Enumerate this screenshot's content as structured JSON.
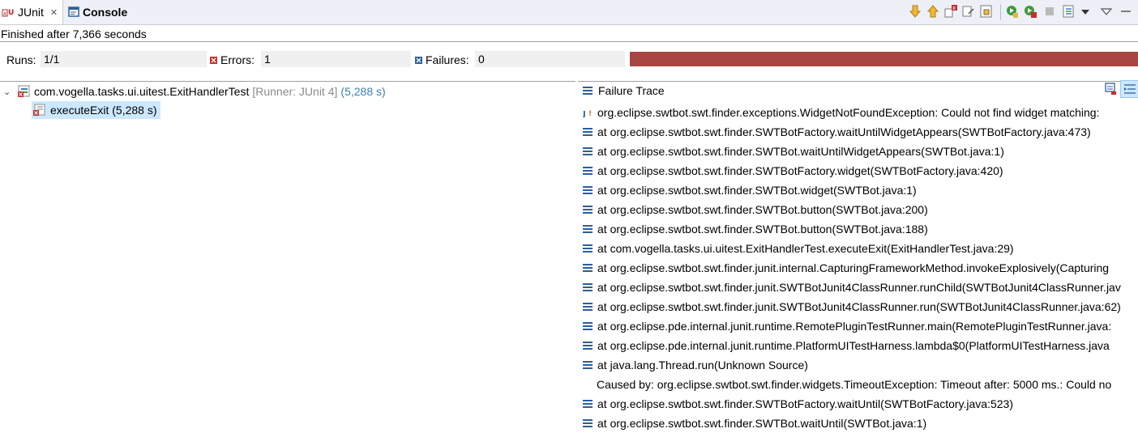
{
  "tabs": [
    {
      "label": "JUnit",
      "active": true
    },
    {
      "label": "Console",
      "active": false
    }
  ],
  "status_text": "Finished after 7,366 seconds",
  "counters": {
    "runs_label": "Runs:",
    "runs_value": "1/1",
    "errors_label": "Errors:",
    "errors_value": "1",
    "failures_label": "Failures:",
    "failures_value": "0"
  },
  "colors": {
    "progress_fail": "#a94543",
    "link_time": "#3a7fb5",
    "selection": "#cce8ff"
  },
  "tree": {
    "suite_label": "com.vogella.tasks.ui.uitest.ExitHandlerTest",
    "suite_runner": "[Runner: JUnit 4]",
    "suite_time": "(5,288 s)",
    "test_label": "executeExit (5,288 s)"
  },
  "failure_trace": {
    "title": "Failure Trace",
    "lines": [
      {
        "icon": "exception-icon",
        "text": "org.eclipse.swtbot.swt.finder.exceptions.WidgetNotFoundException: Could not find widget matching:"
      },
      {
        "icon": "stack-frame-icon",
        "text": "at org.eclipse.swtbot.swt.finder.SWTBotFactory.waitUntilWidgetAppears(SWTBotFactory.java:473)"
      },
      {
        "icon": "stack-frame-icon",
        "text": "at org.eclipse.swtbot.swt.finder.SWTBot.waitUntilWidgetAppears(SWTBot.java:1)"
      },
      {
        "icon": "stack-frame-icon",
        "text": "at org.eclipse.swtbot.swt.finder.SWTBotFactory.widget(SWTBotFactory.java:420)"
      },
      {
        "icon": "stack-frame-icon",
        "text": "at org.eclipse.swtbot.swt.finder.SWTBot.widget(SWTBot.java:1)"
      },
      {
        "icon": "stack-frame-icon",
        "text": "at org.eclipse.swtbot.swt.finder.SWTBot.button(SWTBot.java:200)"
      },
      {
        "icon": "stack-frame-icon",
        "text": "at org.eclipse.swtbot.swt.finder.SWTBot.button(SWTBot.java:188)"
      },
      {
        "icon": "stack-frame-icon",
        "text": "at com.vogella.tasks.ui.uitest.ExitHandlerTest.executeExit(ExitHandlerTest.java:29)"
      },
      {
        "icon": "stack-frame-icon",
        "text": "at org.eclipse.swtbot.swt.finder.junit.internal.CapturingFrameworkMethod.invokeExplosively(Capturing"
      },
      {
        "icon": "stack-frame-icon",
        "text": "at org.eclipse.swtbot.swt.finder.junit.SWTBotJunit4ClassRunner.runChild(SWTBotJunit4ClassRunner.jav"
      },
      {
        "icon": "stack-frame-icon",
        "text": "at org.eclipse.swtbot.swt.finder.junit.SWTBotJunit4ClassRunner.run(SWTBotJunit4ClassRunner.java:62)"
      },
      {
        "icon": "stack-frame-icon",
        "text": "at org.eclipse.pde.internal.junit.runtime.RemotePluginTestRunner.main(RemotePluginTestRunner.java:"
      },
      {
        "icon": "stack-frame-icon",
        "text": "at org.eclipse.pde.internal.junit.runtime.PlatformUITestHarness.lambda$0(PlatformUITestHarness.java"
      },
      {
        "icon": "stack-frame-icon",
        "text": "at java.lang.Thread.run(Unknown Source)"
      },
      {
        "icon": "",
        "text": "Caused by: org.eclipse.swtbot.swt.finder.widgets.TimeoutException: Timeout after: 5000 ms.: Could no"
      },
      {
        "icon": "stack-frame-icon",
        "text": "at org.eclipse.swtbot.swt.finder.SWTBotFactory.waitUntil(SWTBotFactory.java:523)"
      },
      {
        "icon": "stack-frame-icon",
        "text": "at org.eclipse.swtbot.swt.finder.SWTBot.waitUntil(SWTBot.java:1)"
      }
    ]
  }
}
